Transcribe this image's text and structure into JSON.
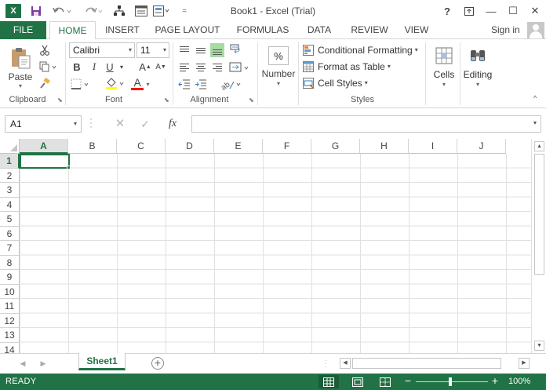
{
  "app": {
    "title": "Book1 - Excel (Trial)",
    "logo_letter": "X",
    "brand_color": "#217346"
  },
  "quick_access": {
    "icons": [
      "save-icon",
      "undo-icon",
      "redo-icon",
      "tree-icon",
      "form-icon",
      "view-icon"
    ],
    "more": "="
  },
  "window_controls": {
    "help": "?",
    "minimize": "—",
    "maximize": "☐",
    "close": "✕"
  },
  "tabs": {
    "file": "FILE",
    "home": "HOME",
    "insert": "INSERT",
    "page_layout": "PAGE LAYOUT",
    "formulas": "FORMULAS",
    "data": "DATA",
    "review": "REVIEW",
    "view": "VIEW",
    "active": "HOME"
  },
  "account": {
    "sign_in": "Sign in"
  },
  "ribbon": {
    "clipboard": {
      "label": "Clipboard",
      "paste": "Paste"
    },
    "font": {
      "label": "Font",
      "name": "Calibri",
      "size": "11",
      "bold": "B",
      "italic": "I",
      "underline": "U",
      "grow": "A",
      "shrink": "A",
      "font_color_glyph": "A",
      "fill_color": "#ffff00",
      "font_color": "#ff0000"
    },
    "alignment": {
      "label": "Alignment"
    },
    "number": {
      "label": "Number",
      "glyph": "%"
    },
    "styles": {
      "label": "Styles",
      "conditional_formatting": "Conditional Formatting",
      "format_as_table": "Format as Table",
      "cell_styles": "Cell Styles"
    },
    "cells": {
      "label": "Cells"
    },
    "editing": {
      "label": "Editing"
    }
  },
  "formula_bar": {
    "name_box": "A1",
    "cancel": "✕",
    "enter": "✓",
    "fx": "fx",
    "value": ""
  },
  "grid": {
    "columns": [
      "A",
      "B",
      "C",
      "D",
      "E",
      "F",
      "G",
      "H",
      "I",
      "J"
    ],
    "rows": [
      "1",
      "2",
      "3",
      "4",
      "5",
      "6",
      "7",
      "8",
      "9",
      "10",
      "11",
      "12",
      "13",
      "14"
    ],
    "selected_cell": "A1"
  },
  "sheets": {
    "tabs": [
      "Sheet1"
    ],
    "active": "Sheet1",
    "add": "+"
  },
  "status": {
    "text": "READY",
    "zoom": "100%",
    "zoom_out": "−",
    "zoom_in": "+"
  }
}
